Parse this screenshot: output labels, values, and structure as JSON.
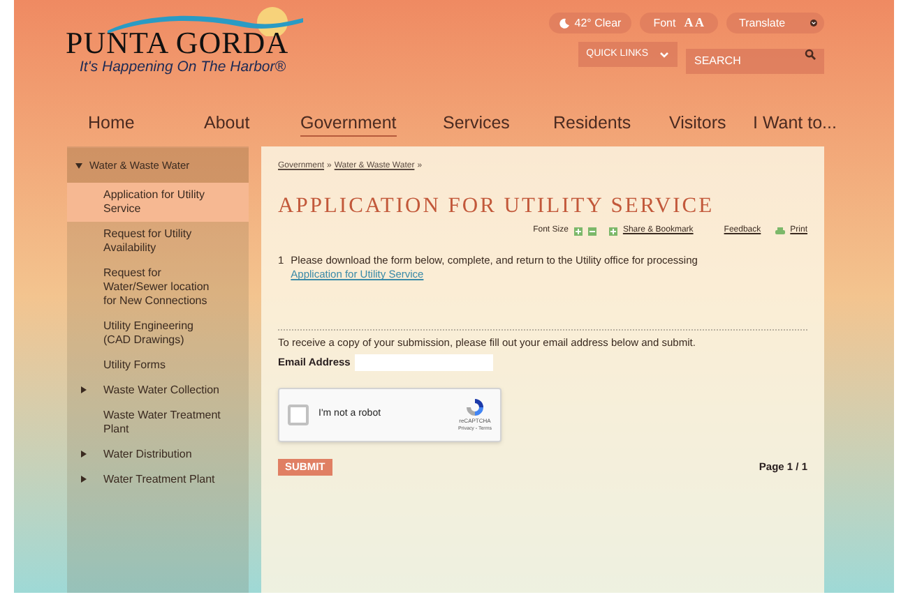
{
  "logo": {
    "name": "PUNTA GORDA",
    "tagline": "It's Happening On The Harbor®"
  },
  "utility": {
    "weather": "42° Clear",
    "font_label": "Font",
    "font_glyph": "A A",
    "translate": "Translate",
    "quick_links": "QUICK LINKS",
    "search_placeholder": "SEARCH"
  },
  "nav": [
    {
      "label": "Home",
      "selected": false
    },
    {
      "label": "About",
      "selected": false
    },
    {
      "label": "Government",
      "selected": true
    },
    {
      "label": "Services",
      "selected": false
    },
    {
      "label": "Residents",
      "selected": false
    },
    {
      "label": "Visitors",
      "selected": false
    },
    {
      "label": "I Want to...",
      "selected": false
    }
  ],
  "sidebar": {
    "items": [
      {
        "label": "Water & Waste Water",
        "expanded": true,
        "children": [
          {
            "label": "Application for Utility Service",
            "selected": true
          },
          {
            "label": "Request for Utility Availability",
            "selected": false
          },
          {
            "label": "Request for Water/Sewer location for New Connections",
            "selected": false
          },
          {
            "label": "Utility Engineering (CAD Drawings)",
            "selected": false
          },
          {
            "label": "Utility Forms",
            "selected": false
          },
          {
            "label": "Waste Water Collection",
            "selected": false,
            "has_children": true
          },
          {
            "label": "Waste Water Treatment Plant",
            "selected": false
          },
          {
            "label": "Water Distribution",
            "selected": false,
            "has_children": true
          },
          {
            "label": "Water Treatment Plant",
            "selected": false,
            "has_children": true
          }
        ]
      }
    ]
  },
  "breadcrumb": [
    {
      "label": "Government"
    },
    {
      "label": "Water & Waste Water"
    }
  ],
  "breadcrumb_separator": "»",
  "title": "APPLICATION FOR UTILITY SERVICE",
  "tools": {
    "font_size": "Font Size",
    "share": "Share & Bookmark",
    "feedback": "Feedback",
    "print": "Print"
  },
  "steps": [
    {
      "number": "1",
      "text": "Please download the form below, complete, and return to the Utility office for processing",
      "link": "Application for Utility Service"
    }
  ],
  "form": {
    "intro": "To receive a copy of your submission, please fill out your email address below and submit.",
    "email_label": "Email Address",
    "captcha": {
      "label": "I'm not a robot",
      "checked": false,
      "brand": "reCAPTCHA",
      "links": "Privacy - Terms"
    },
    "submit": "SUBMIT",
    "page": "Page 1 / 1"
  }
}
